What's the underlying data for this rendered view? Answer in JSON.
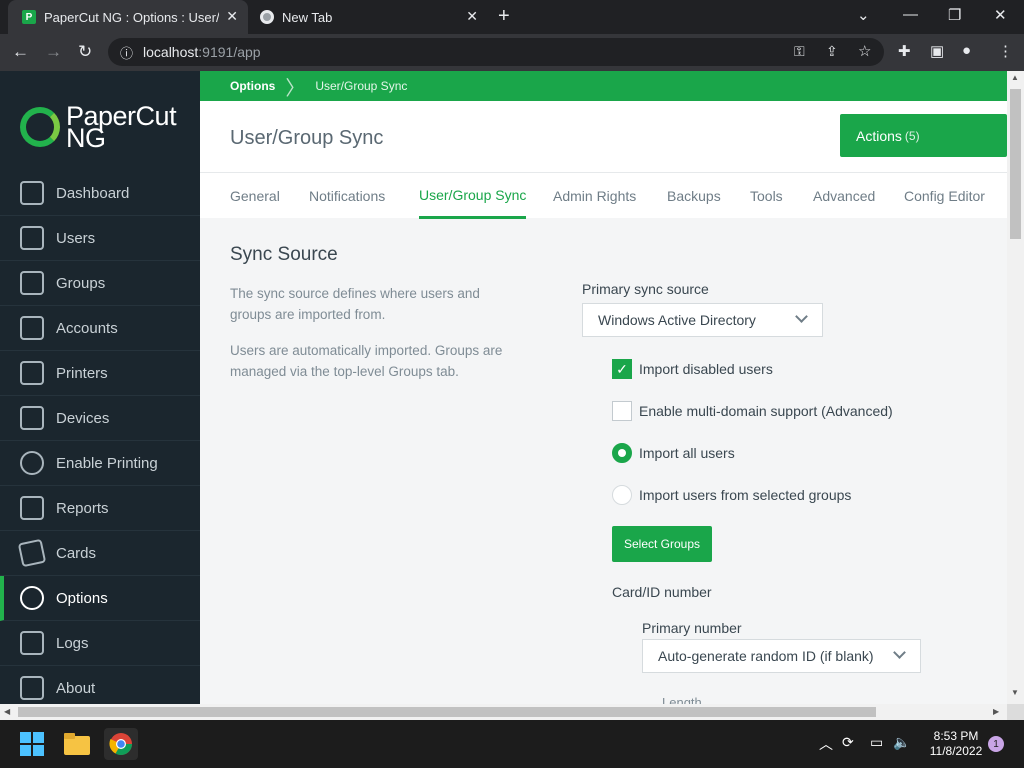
{
  "browser": {
    "tabs": [
      {
        "title": "PaperCut NG : Options : User/Group Sync"
      },
      {
        "title": "New Tab"
      }
    ],
    "new_tab_label": "+",
    "url_host": "localhost",
    "url_rest": ":9191/app"
  },
  "sidebar": {
    "logo_text_line1": "PaperCut",
    "logo_text_line2": "NG",
    "items": [
      {
        "label": "Dashboard",
        "icon": "dashboard-icon"
      },
      {
        "label": "Users",
        "icon": "users-icon"
      },
      {
        "label": "Groups",
        "icon": "groups-icon"
      },
      {
        "label": "Accounts",
        "icon": "accounts-icon"
      },
      {
        "label": "Printers",
        "icon": "printer-icon"
      },
      {
        "label": "Devices",
        "icon": "devices-icon"
      },
      {
        "label": "Enable Printing",
        "icon": "enable-printing-icon"
      },
      {
        "label": "Reports",
        "icon": "reports-icon"
      },
      {
        "label": "Cards",
        "icon": "cards-icon"
      },
      {
        "label": "Options",
        "icon": "gear-icon",
        "active": true
      },
      {
        "label": "Logs",
        "icon": "logs-icon"
      },
      {
        "label": "About",
        "icon": "about-icon"
      }
    ]
  },
  "breadcrumb": {
    "root": "Options",
    "current": "User/Group Sync"
  },
  "header": {
    "title": "User/Group Sync",
    "actions_label": "Actions",
    "actions_count": "(5)"
  },
  "page_tabs": [
    {
      "label": "General"
    },
    {
      "label": "Notifications"
    },
    {
      "label": "User/Group Sync",
      "active": true
    },
    {
      "label": "Admin Rights"
    },
    {
      "label": "Backups"
    },
    {
      "label": "Tools"
    },
    {
      "label": "Advanced"
    },
    {
      "label": "Config Editor"
    }
  ],
  "sync": {
    "title": "Sync Source",
    "desc1": "The sync source defines where users and groups are imported from.",
    "desc2": "Users are automatically imported. Groups are managed via the top-level Groups tab.",
    "primary_label": "Primary sync source",
    "primary_value": "Windows Active Directory",
    "import_disabled": "Import disabled users",
    "multi_domain": "Enable multi-domain support (Advanced)",
    "import_all": "Import all users",
    "import_selected": "Import users from selected groups",
    "select_groups": "Select Groups",
    "card_label": "Card/ID number",
    "primary_number_label": "Primary number",
    "primary_number_value": "Auto-generate random ID (if blank)",
    "length_label": "Length"
  },
  "taskbar": {
    "time": "8:53 PM",
    "date": "11/8/2022",
    "notifications": "1"
  },
  "colors": {
    "accent": "#1aa64a",
    "sidebar": "#1b262e"
  }
}
